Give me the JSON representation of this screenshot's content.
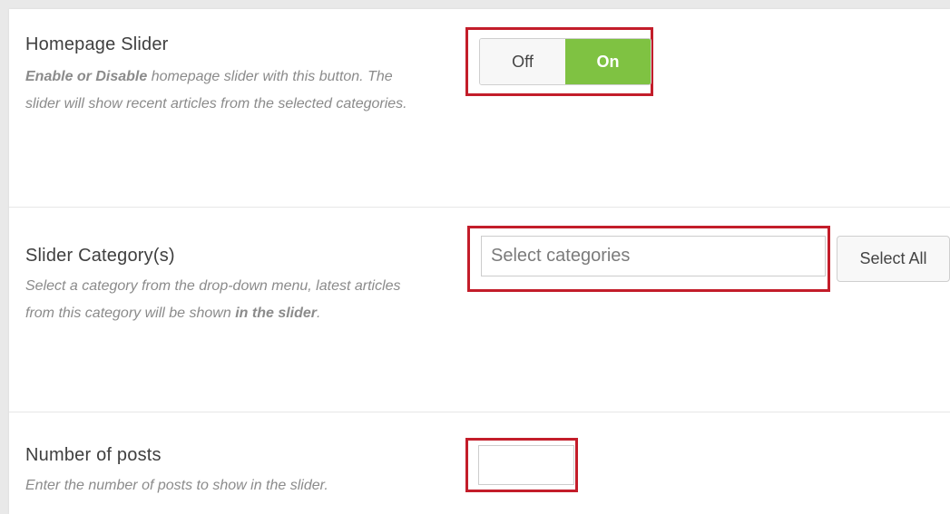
{
  "homepage_slider": {
    "title": "Homepage Slider",
    "desc_bold": "Enable or Disable",
    "desc_rest": " homepage slider with this button. The slider will show recent articles from the selected categories.",
    "toggle_off_label": "Off",
    "toggle_on_label": "On",
    "state": "On"
  },
  "slider_categories": {
    "title": "Slider Category(s)",
    "desc_main": "Select a category from the drop-down menu, latest articles from this category will be shown ",
    "desc_bold": "in the slider",
    "desc_end": ".",
    "placeholder": "Select categories",
    "select_all_label": "Select All"
  },
  "number_of_posts": {
    "title": "Number of posts",
    "desc": "Enter the number of posts to show in the slider.",
    "value": ""
  },
  "colors": {
    "highlight_border": "#c31d2a",
    "toggle_on": "#7fc242"
  }
}
